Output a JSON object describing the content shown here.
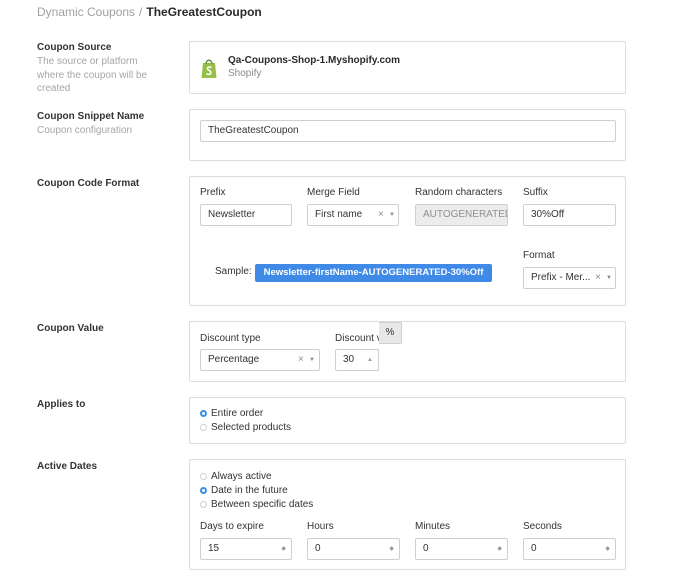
{
  "breadcrumb": {
    "parent": "Dynamic Coupons",
    "separator": "/",
    "current": "TheGreatestCoupon"
  },
  "coupon_source": {
    "title": "Coupon Source",
    "description": "The source or platform where the coupon will be created",
    "shop_name": "Qa-Coupons-Shop-1.Myshopify.com",
    "platform": "Shopify",
    "logo_color": "#95bf47"
  },
  "snippet_name": {
    "title": "Coupon Snippet Name",
    "description": "Coupon configuration",
    "value": "TheGreatestCoupon"
  },
  "code_format": {
    "title": "Coupon Code Format",
    "prefix_label": "Prefix",
    "prefix_value": "Newsletter",
    "merge_label": "Merge Field",
    "merge_value": "First name",
    "random_label": "Random characters",
    "random_value": "AUTOGENERATED",
    "suffix_label": "Suffix",
    "suffix_value": "30%Off",
    "sample_label": "Sample:",
    "sample_value": "Newsletter-firstName-AUTOGENERATED-30%Off",
    "format_label": "Format",
    "format_value": "Prefix - Mer...",
    "clear_icon": "×",
    "caret_icon": "▼",
    "accent": "#3f8ae6"
  },
  "coupon_value": {
    "title": "Coupon Value",
    "discount_type_label": "Discount type",
    "discount_type_value": "Percentage",
    "discount_value_label": "Discount value",
    "discount_value": "30",
    "unit": "%"
  },
  "applies_to": {
    "title": "Applies to",
    "options": [
      "Entire order",
      "Selected products"
    ],
    "selected": 0
  },
  "active_dates": {
    "title": "Active Dates",
    "options": [
      "Always active",
      "Date in the future",
      "Between specific dates"
    ],
    "selected": 1,
    "days_label": "Days to expire",
    "days_value": "15",
    "hours_label": "Hours",
    "hours_value": "0",
    "minutes_label": "Minutes",
    "minutes_value": "0",
    "seconds_label": "Seconds",
    "seconds_value": "0"
  }
}
